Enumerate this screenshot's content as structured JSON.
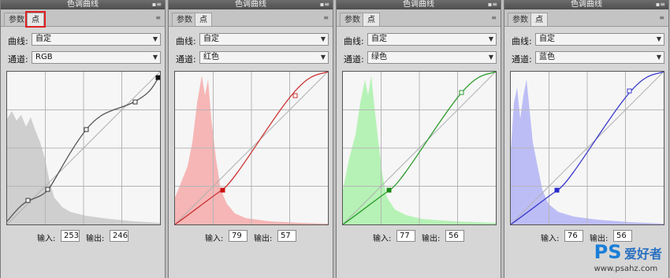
{
  "panels": [
    {
      "title": "色调曲线",
      "tabs": [
        "参数",
        "点"
      ],
      "curve_label": "曲线:",
      "curve_value": "自定",
      "channel_label": "通道:",
      "channel_value": "RGB",
      "input_label": "输入:",
      "input_value": "253",
      "output_label": "输出:",
      "output_value": "246",
      "color": "#555555",
      "histogram_color": "#c9c9c9"
    },
    {
      "title": "色调曲线",
      "tabs": [
        "参数",
        "点"
      ],
      "curve_label": "曲线:",
      "curve_value": "自定",
      "channel_label": "通道:",
      "channel_value": "红色",
      "input_label": "输入:",
      "input_value": "79",
      "output_label": "输出:",
      "output_value": "57",
      "color": "#cc3333",
      "histogram_color": "#f5b3b3"
    },
    {
      "title": "色调曲线",
      "tabs": [
        "参数",
        "点"
      ],
      "curve_label": "曲线:",
      "curve_value": "自定",
      "channel_label": "通道:",
      "channel_value": "绿色",
      "input_label": "输入:",
      "input_value": "77",
      "output_label": "输出:",
      "output_value": "56",
      "color": "#2a9a2a",
      "histogram_color": "#b3f0b3"
    },
    {
      "title": "色调曲线",
      "tabs": [
        "参数",
        "点"
      ],
      "curve_label": "曲线:",
      "curve_value": "自定",
      "channel_label": "通道:",
      "channel_value": "蓝色",
      "input_label": "输入:",
      "input_value": "76",
      "output_label": "输出:",
      "output_value": "56",
      "color": "#3a3acc",
      "histogram_color": "#bbbbf5"
    }
  ],
  "watermark": {
    "logo": "PS",
    "text": "爱好者",
    "url": "www.psahz.com"
  }
}
